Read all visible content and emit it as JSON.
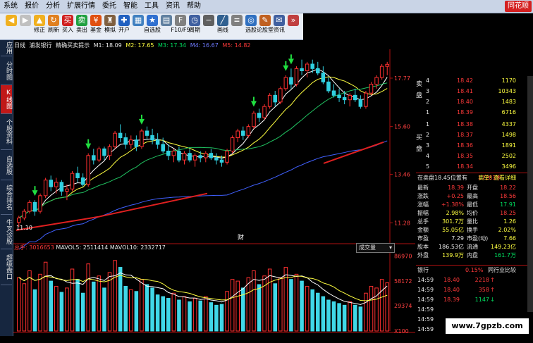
{
  "menu": [
    "系统",
    "报价",
    "分析",
    "扩展行情",
    "委托",
    "智能",
    "工具",
    "资讯",
    "帮助"
  ],
  "brand": "同花顺",
  "toolbar": [
    {
      "label": "",
      "icon": "back-arrow-icon",
      "color": "#f0b020"
    },
    {
      "label": "",
      "icon": "forward-arrow-icon",
      "color": "#c0c0c0"
    },
    {
      "label": "修正",
      "icon": "up-arrow-icon",
      "color": "#f0b020"
    },
    {
      "label": "刷新",
      "icon": "refresh-icon",
      "color": "#e08020"
    },
    {
      "label": "买入",
      "icon": "buy-icon",
      "color": "#d02020"
    },
    {
      "label": "卖出",
      "icon": "sell-icon",
      "color": "#20a040"
    },
    {
      "label": "基金",
      "icon": "fund-icon",
      "color": "#e05010"
    },
    {
      "label": "模拟",
      "icon": "simulate-icon",
      "color": "#806040"
    },
    {
      "label": "开户",
      "icon": "account-icon",
      "color": "#2060c0"
    },
    {
      "label": "",
      "icon": "grid-icon",
      "color": "#4080c0"
    },
    {
      "label": "自选股",
      "icon": "watchlist-icon",
      "color": "#3070d0"
    },
    {
      "label": "",
      "icon": "chart-icon",
      "color": "#6080a0"
    },
    {
      "label": "F10/F9",
      "icon": "f10-icon",
      "color": "#808080"
    },
    {
      "label": "周期",
      "icon": "cycle-icon",
      "color": "#4060a0"
    },
    {
      "label": "",
      "icon": "minus-icon",
      "color": "#606060"
    },
    {
      "label": "画线",
      "icon": "draw-line-icon",
      "color": "#306090"
    },
    {
      "label": "",
      "icon": "list-icon",
      "color": "#808080"
    },
    {
      "label": "选股",
      "icon": "stock-select-icon",
      "color": "#3070c0"
    },
    {
      "label": "论股堂",
      "icon": "forum-icon",
      "color": "#c06020"
    },
    {
      "label": "资讯",
      "icon": "news-icon",
      "color": "#4060a0"
    },
    {
      "label": "",
      "icon": "more-icon",
      "color": "#c04040"
    }
  ],
  "lefttabs": [
    "应用",
    "分时图",
    "K线图",
    "个股资料",
    "自选股",
    "综合排名",
    "牛叉诊股",
    "超级盘口"
  ],
  "legend": {
    "period": "日线",
    "name": "浦发银行",
    "indicator": "精确买卖提示",
    "m1": "M1: 18.09",
    "m2": "M2: 17.65",
    "m3": "M3: 17.34",
    "m4": "M4: 16.67",
    "m5": "M5: 14.82"
  },
  "volume": {
    "label": "总手: 3016653",
    "mavol5": "MAVOL5: 2511414",
    "mavol10": "MAVOL10: 2332717",
    "select": "成交量"
  },
  "finance_mark": "财",
  "low_label": "11.10",
  "price_axis": [
    "17.77",
    "15.60",
    "13.46",
    "11.28"
  ],
  "volume_axis": [
    "86970",
    "58172",
    "29374",
    "X100"
  ],
  "chart_data": {
    "type": "candlestick",
    "ylim": [
      10.6,
      19.0
    ],
    "volume_ylim": [
      0,
      90000
    ],
    "candles": [
      [
        11.3,
        11.6,
        11.1,
        11.5
      ],
      [
        11.5,
        11.9,
        11.4,
        11.8
      ],
      [
        11.8,
        12.3,
        11.7,
        12.2
      ],
      [
        12.2,
        12.3,
        11.6,
        11.8
      ],
      [
        11.8,
        12.6,
        11.7,
        12.5
      ],
      [
        12.5,
        13.3,
        12.4,
        13.2
      ],
      [
        13.2,
        13.4,
        12.7,
        12.9
      ],
      [
        12.9,
        13.3,
        12.6,
        13.1
      ],
      [
        13.1,
        13.2,
        12.5,
        12.7
      ],
      [
        12.7,
        13.0,
        12.3,
        12.8
      ],
      [
        12.8,
        13.6,
        12.7,
        13.5
      ],
      [
        13.5,
        13.8,
        13.1,
        13.3
      ],
      [
        13.3,
        13.5,
        12.9,
        13.0
      ],
      [
        13.0,
        14.4,
        12.9,
        14.3
      ],
      [
        14.3,
        14.6,
        13.9,
        14.1
      ],
      [
        14.1,
        14.7,
        14.0,
        14.6
      ],
      [
        14.6,
        14.7,
        14.1,
        14.3
      ],
      [
        14.3,
        14.8,
        14.1,
        14.7
      ],
      [
        14.7,
        15.4,
        14.6,
        15.3
      ],
      [
        15.3,
        15.7,
        14.9,
        15.1
      ],
      [
        15.1,
        15.3,
        14.6,
        14.8
      ],
      [
        14.8,
        15.2,
        14.6,
        15.0
      ],
      [
        15.0,
        15.2,
        14.5,
        14.7
      ],
      [
        14.7,
        15.5,
        14.6,
        15.4
      ],
      [
        15.4,
        15.6,
        15.0,
        15.2
      ],
      [
        15.2,
        15.5,
        14.8,
        15.0
      ],
      [
        15.0,
        15.3,
        14.6,
        14.8
      ],
      [
        14.8,
        15.1,
        14.4,
        14.5
      ],
      [
        14.5,
        14.8,
        14.1,
        14.3
      ],
      [
        14.3,
        14.6,
        14.0,
        14.5
      ],
      [
        14.5,
        14.7,
        14.0,
        14.1
      ],
      [
        14.1,
        14.5,
        13.9,
        14.4
      ],
      [
        14.4,
        14.6,
        14.0,
        14.1
      ],
      [
        14.1,
        14.4,
        13.8,
        14.3
      ],
      [
        14.3,
        14.5,
        14.0,
        14.2
      ],
      [
        14.2,
        14.5,
        14.0,
        14.4
      ],
      [
        14.4,
        14.6,
        14.1,
        14.2
      ],
      [
        14.2,
        14.4,
        13.9,
        14.1
      ],
      [
        14.1,
        14.3,
        13.8,
        14.0
      ],
      [
        14.0,
        14.6,
        13.9,
        14.5
      ],
      [
        14.5,
        15.2,
        14.4,
        15.1
      ],
      [
        15.1,
        15.5,
        14.9,
        15.4
      ],
      [
        15.4,
        15.6,
        15.0,
        15.2
      ],
      [
        15.2,
        15.7,
        15.1,
        15.6
      ],
      [
        15.6,
        16.3,
        15.5,
        16.2
      ],
      [
        16.2,
        16.4,
        15.8,
        16.0
      ],
      [
        16.0,
        16.6,
        15.9,
        16.5
      ],
      [
        16.5,
        17.1,
        16.4,
        17.0
      ],
      [
        17.0,
        17.2,
        16.5,
        16.7
      ],
      [
        16.7,
        17.4,
        16.6,
        17.3
      ],
      [
        17.3,
        17.9,
        17.2,
        17.8
      ],
      [
        17.8,
        18.2,
        17.3,
        17.5
      ],
      [
        17.5,
        18.3,
        17.4,
        18.2
      ],
      [
        18.2,
        18.6,
        17.9,
        18.1
      ],
      [
        18.1,
        18.5,
        17.8,
        18.4
      ],
      [
        18.4,
        18.6,
        18.0,
        18.2
      ],
      [
        18.2,
        18.5,
        17.9,
        18.0
      ],
      [
        18.0,
        18.3,
        17.5,
        17.6
      ],
      [
        17.6,
        17.8,
        17.1,
        17.2
      ],
      [
        17.2,
        17.5,
        16.9,
        17.0
      ],
      [
        17.0,
        17.3,
        16.7,
        16.9
      ],
      [
        16.9,
        17.2,
        16.6,
        16.8
      ],
      [
        16.8,
        17.1,
        16.5,
        17.0
      ],
      [
        17.0,
        17.3,
        16.7,
        16.8
      ],
      [
        16.8,
        17.0,
        16.4,
        16.5
      ],
      [
        16.5,
        17.2,
        16.4,
        17.1
      ],
      [
        17.1,
        17.6,
        17.0,
        17.5
      ],
      [
        17.5,
        17.9,
        17.3,
        17.8
      ],
      [
        17.8,
        18.4,
        17.7,
        18.3
      ],
      [
        18.3,
        18.5,
        17.9,
        18.39
      ]
    ],
    "volumes": [
      62,
      55,
      70,
      48,
      66,
      80,
      58,
      52,
      45,
      50,
      72,
      60,
      44,
      78,
      57,
      64,
      50,
      68,
      82,
      74,
      52,
      48,
      46,
      60,
      54,
      50,
      42,
      40,
      38,
      44,
      36,
      40,
      34,
      38,
      35,
      40,
      33,
      30,
      31,
      46,
      60,
      58,
      50,
      62,
      70,
      54,
      64,
      72,
      55,
      62,
      74,
      60,
      66,
      58,
      52,
      48,
      44,
      40,
      36,
      34,
      32,
      30,
      34,
      30,
      28,
      44,
      52,
      50,
      60,
      56
    ],
    "signals_buy_index": [
      3,
      13,
      23,
      44,
      50,
      51
    ],
    "signals_sell_index": [
      5,
      18,
      53
    ]
  },
  "orderbook": {
    "sell": [
      {
        "lvl": "4",
        "price": "18.42",
        "vol": "1170"
      },
      {
        "lvl": "3",
        "price": "18.41",
        "vol": "10343"
      },
      {
        "lvl": "2",
        "price": "18.40",
        "vol": "1483"
      },
      {
        "lvl": "1",
        "price": "18.39",
        "vol": "6716"
      }
    ],
    "buy": [
      {
        "lvl": "1",
        "price": "18.38",
        "vol": "4337"
      },
      {
        "lvl": "2",
        "price": "18.37",
        "vol": "1498"
      },
      {
        "lvl": "3",
        "price": "18.36",
        "vol": "1891"
      },
      {
        "lvl": "4",
        "price": "18.35",
        "vol": "2502"
      },
      {
        "lvl": "5",
        "price": "18.34",
        "vol": "3496"
      }
    ],
    "sell_side": "卖盘",
    "buy_side": "买盘"
  },
  "info_header": {
    "left": "在卖盘18.45位置有",
    "mid": "17281手",
    "right": "卖单! 查看详细"
  },
  "stats": [
    {
      "l1": "最新",
      "v1": "18.39",
      "l2": "开盘",
      "v2": "18.22"
    },
    {
      "l1": "涨跌",
      "v1": "+0.25",
      "l2": "最高",
      "v2": "18.56"
    },
    {
      "l1": "涨幅",
      "v1": "+1.38%",
      "l2": "最低",
      "v2": "17.91"
    },
    {
      "l1": "振幅",
      "v1": "2.98%",
      "l2": "均价",
      "v2": "18.25"
    },
    {
      "l1": "总手",
      "v1": "301.7万",
      "l2": "量比",
      "v2": "1.26"
    },
    {
      "l1": "金额",
      "v1": "55.05亿",
      "l2": "换手",
      "v2": "2.02%"
    },
    {
      "l1": "市盈",
      "v1": "7.29",
      "l2": "市盈(动)",
      "v2": "7.66"
    },
    {
      "l1": "股本",
      "v1": "186.53亿",
      "l2": "流通",
      "v2": "149.23亿"
    },
    {
      "l1": "外盘",
      "v1": "139.9万",
      "l2": "内盘",
      "v2": "161.7万"
    }
  ],
  "sector": {
    "name": "银行",
    "pct": "0.15%",
    "link": "同行业比较"
  },
  "trades": [
    {
      "time": "14:59",
      "price": "18.40",
      "vol": "2218",
      "dir": "up"
    },
    {
      "time": "14:59",
      "price": "18.40",
      "vol": "358",
      "dir": "up"
    },
    {
      "time": "14:59",
      "price": "18.39",
      "vol": "1147",
      "dir": "down"
    },
    {
      "time": "14:59",
      "price": "",
      "vol": "",
      "dir": ""
    },
    {
      "time": "14:59",
      "price": "",
      "vol": "",
      "dir": ""
    },
    {
      "time": "14:59",
      "price": "",
      "vol": "",
      "dir": ""
    }
  ],
  "watermark": "www.7gpzb.com"
}
